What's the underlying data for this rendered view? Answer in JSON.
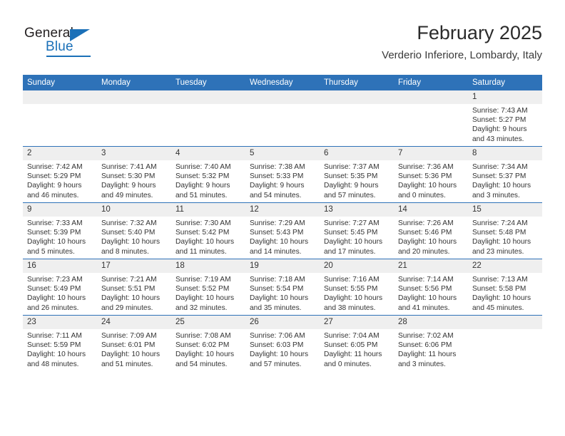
{
  "brand": {
    "name_top": "General",
    "name_bottom": "Blue",
    "triangle_color": "#1b70b8",
    "text_color": "#231f20"
  },
  "header": {
    "month_title": "February 2025",
    "location": "Verderio Inferiore, Lombardy, Italy"
  },
  "theme": {
    "header_blue": "#2e72b8",
    "daynum_band": "#efefef",
    "page_background": "#ffffff",
    "text": "#333333"
  },
  "weekday_headers": [
    "Sunday",
    "Monday",
    "Tuesday",
    "Wednesday",
    "Thursday",
    "Friday",
    "Saturday"
  ],
  "weeks": [
    [
      {
        "day": "",
        "empty": true
      },
      {
        "day": "",
        "empty": true
      },
      {
        "day": "",
        "empty": true
      },
      {
        "day": "",
        "empty": true
      },
      {
        "day": "",
        "empty": true
      },
      {
        "day": "",
        "empty": true
      },
      {
        "day": "1",
        "sunrise": "Sunrise: 7:43 AM",
        "sunset": "Sunset: 5:27 PM",
        "daylight_line1": "Daylight: 9 hours",
        "daylight_line2": "and 43 minutes."
      }
    ],
    [
      {
        "day": "2",
        "sunrise": "Sunrise: 7:42 AM",
        "sunset": "Sunset: 5:29 PM",
        "daylight_line1": "Daylight: 9 hours",
        "daylight_line2": "and 46 minutes."
      },
      {
        "day": "3",
        "sunrise": "Sunrise: 7:41 AM",
        "sunset": "Sunset: 5:30 PM",
        "daylight_line1": "Daylight: 9 hours",
        "daylight_line2": "and 49 minutes."
      },
      {
        "day": "4",
        "sunrise": "Sunrise: 7:40 AM",
        "sunset": "Sunset: 5:32 PM",
        "daylight_line1": "Daylight: 9 hours",
        "daylight_line2": "and 51 minutes."
      },
      {
        "day": "5",
        "sunrise": "Sunrise: 7:38 AM",
        "sunset": "Sunset: 5:33 PM",
        "daylight_line1": "Daylight: 9 hours",
        "daylight_line2": "and 54 minutes."
      },
      {
        "day": "6",
        "sunrise": "Sunrise: 7:37 AM",
        "sunset": "Sunset: 5:35 PM",
        "daylight_line1": "Daylight: 9 hours",
        "daylight_line2": "and 57 minutes."
      },
      {
        "day": "7",
        "sunrise": "Sunrise: 7:36 AM",
        "sunset": "Sunset: 5:36 PM",
        "daylight_line1": "Daylight: 10 hours",
        "daylight_line2": "and 0 minutes."
      },
      {
        "day": "8",
        "sunrise": "Sunrise: 7:34 AM",
        "sunset": "Sunset: 5:37 PM",
        "daylight_line1": "Daylight: 10 hours",
        "daylight_line2": "and 3 minutes."
      }
    ],
    [
      {
        "day": "9",
        "sunrise": "Sunrise: 7:33 AM",
        "sunset": "Sunset: 5:39 PM",
        "daylight_line1": "Daylight: 10 hours",
        "daylight_line2": "and 5 minutes."
      },
      {
        "day": "10",
        "sunrise": "Sunrise: 7:32 AM",
        "sunset": "Sunset: 5:40 PM",
        "daylight_line1": "Daylight: 10 hours",
        "daylight_line2": "and 8 minutes."
      },
      {
        "day": "11",
        "sunrise": "Sunrise: 7:30 AM",
        "sunset": "Sunset: 5:42 PM",
        "daylight_line1": "Daylight: 10 hours",
        "daylight_line2": "and 11 minutes."
      },
      {
        "day": "12",
        "sunrise": "Sunrise: 7:29 AM",
        "sunset": "Sunset: 5:43 PM",
        "daylight_line1": "Daylight: 10 hours",
        "daylight_line2": "and 14 minutes."
      },
      {
        "day": "13",
        "sunrise": "Sunrise: 7:27 AM",
        "sunset": "Sunset: 5:45 PM",
        "daylight_line1": "Daylight: 10 hours",
        "daylight_line2": "and 17 minutes."
      },
      {
        "day": "14",
        "sunrise": "Sunrise: 7:26 AM",
        "sunset": "Sunset: 5:46 PM",
        "daylight_line1": "Daylight: 10 hours",
        "daylight_line2": "and 20 minutes."
      },
      {
        "day": "15",
        "sunrise": "Sunrise: 7:24 AM",
        "sunset": "Sunset: 5:48 PM",
        "daylight_line1": "Daylight: 10 hours",
        "daylight_line2": "and 23 minutes."
      }
    ],
    [
      {
        "day": "16",
        "sunrise": "Sunrise: 7:23 AM",
        "sunset": "Sunset: 5:49 PM",
        "daylight_line1": "Daylight: 10 hours",
        "daylight_line2": "and 26 minutes."
      },
      {
        "day": "17",
        "sunrise": "Sunrise: 7:21 AM",
        "sunset": "Sunset: 5:51 PM",
        "daylight_line1": "Daylight: 10 hours",
        "daylight_line2": "and 29 minutes."
      },
      {
        "day": "18",
        "sunrise": "Sunrise: 7:19 AM",
        "sunset": "Sunset: 5:52 PM",
        "daylight_line1": "Daylight: 10 hours",
        "daylight_line2": "and 32 minutes."
      },
      {
        "day": "19",
        "sunrise": "Sunrise: 7:18 AM",
        "sunset": "Sunset: 5:54 PM",
        "daylight_line1": "Daylight: 10 hours",
        "daylight_line2": "and 35 minutes."
      },
      {
        "day": "20",
        "sunrise": "Sunrise: 7:16 AM",
        "sunset": "Sunset: 5:55 PM",
        "daylight_line1": "Daylight: 10 hours",
        "daylight_line2": "and 38 minutes."
      },
      {
        "day": "21",
        "sunrise": "Sunrise: 7:14 AM",
        "sunset": "Sunset: 5:56 PM",
        "daylight_line1": "Daylight: 10 hours",
        "daylight_line2": "and 41 minutes."
      },
      {
        "day": "22",
        "sunrise": "Sunrise: 7:13 AM",
        "sunset": "Sunset: 5:58 PM",
        "daylight_line1": "Daylight: 10 hours",
        "daylight_line2": "and 45 minutes."
      }
    ],
    [
      {
        "day": "23",
        "sunrise": "Sunrise: 7:11 AM",
        "sunset": "Sunset: 5:59 PM",
        "daylight_line1": "Daylight: 10 hours",
        "daylight_line2": "and 48 minutes."
      },
      {
        "day": "24",
        "sunrise": "Sunrise: 7:09 AM",
        "sunset": "Sunset: 6:01 PM",
        "daylight_line1": "Daylight: 10 hours",
        "daylight_line2": "and 51 minutes."
      },
      {
        "day": "25",
        "sunrise": "Sunrise: 7:08 AM",
        "sunset": "Sunset: 6:02 PM",
        "daylight_line1": "Daylight: 10 hours",
        "daylight_line2": "and 54 minutes."
      },
      {
        "day": "26",
        "sunrise": "Sunrise: 7:06 AM",
        "sunset": "Sunset: 6:03 PM",
        "daylight_line1": "Daylight: 10 hours",
        "daylight_line2": "and 57 minutes."
      },
      {
        "day": "27",
        "sunrise": "Sunrise: 7:04 AM",
        "sunset": "Sunset: 6:05 PM",
        "daylight_line1": "Daylight: 11 hours",
        "daylight_line2": "and 0 minutes."
      },
      {
        "day": "28",
        "sunrise": "Sunrise: 7:02 AM",
        "sunset": "Sunset: 6:06 PM",
        "daylight_line1": "Daylight: 11 hours",
        "daylight_line2": "and 3 minutes."
      },
      {
        "day": "",
        "empty": true
      }
    ]
  ]
}
